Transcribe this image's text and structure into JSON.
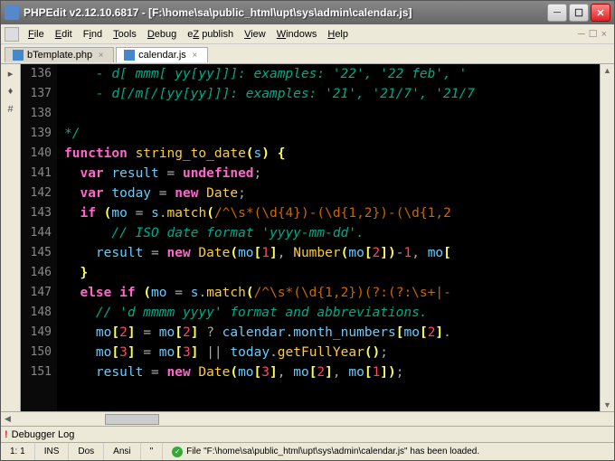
{
  "title": "PHPEdit v2.12.10.6817 - [F:\\home\\sa\\public_html\\upt\\sys\\admin\\calendar.js]",
  "menu": {
    "file": "File",
    "edit": "Edit",
    "find": "Find",
    "tools": "Tools",
    "debug": "Debug",
    "ez": "eZ publish",
    "view": "View",
    "windows": "Windows",
    "help": "Help"
  },
  "tabs": [
    {
      "label": "bTemplate.php",
      "active": false
    },
    {
      "label": "calendar.js",
      "active": true
    }
  ],
  "line_start": 136,
  "line_end": 151,
  "logbar": "Debugger Log",
  "status": {
    "pos": "1: 1",
    "ins": "INS",
    "eol": "Dos",
    "enc": "Ansi",
    "msg": "File \"F:\\home\\sa\\public_html\\upt\\sys\\admin\\calendar.js\" has been loaded."
  },
  "code": [
    [
      [
        "cm",
        "    - d[ mmm[ yy[yy]]]: examples: '22', '22 feb', '"
      ]
    ],
    [
      [
        "cm",
        "    - d[/m[/[yy[yy]]]: examples: '21', '21/7', '21/7"
      ]
    ],
    [],
    [
      [
        "cm",
        "*/"
      ]
    ],
    [
      [
        "kw",
        "function "
      ],
      [
        "fn",
        "string_to_date"
      ],
      [
        "pn",
        "("
      ],
      [
        "id",
        "s"
      ],
      [
        "pn",
        ") {"
      ]
    ],
    [
      [
        "op",
        "  "
      ],
      [
        "kw",
        "var "
      ],
      [
        "id",
        "result "
      ],
      [
        "op",
        "= "
      ],
      [
        "kw",
        "undefined"
      ],
      [
        "op",
        ";"
      ]
    ],
    [
      [
        "op",
        "  "
      ],
      [
        "kw",
        "var "
      ],
      [
        "id",
        "today "
      ],
      [
        "op",
        "= "
      ],
      [
        "kw",
        "new "
      ],
      [
        "fn",
        "Date"
      ],
      [
        "op",
        ";"
      ]
    ],
    [
      [
        "op",
        "  "
      ],
      [
        "kw",
        "if "
      ],
      [
        "pn",
        "("
      ],
      [
        "id",
        "mo "
      ],
      [
        "op",
        "= "
      ],
      [
        "id",
        "s"
      ],
      [
        "op",
        "."
      ],
      [
        "fn",
        "match"
      ],
      [
        "pn",
        "("
      ],
      [
        "re",
        "/^\\s*(\\d{4})-(\\d{1,2})-(\\d{1,2"
      ]
    ],
    [
      [
        "op",
        "      "
      ],
      [
        "cm",
        "// ISO date format 'yyyy-mm-dd'."
      ]
    ],
    [
      [
        "op",
        "    "
      ],
      [
        "id",
        "result "
      ],
      [
        "op",
        "= "
      ],
      [
        "kw",
        "new "
      ],
      [
        "fn",
        "Date"
      ],
      [
        "pn",
        "("
      ],
      [
        "id",
        "mo"
      ],
      [
        "pn",
        "["
      ],
      [
        "num",
        "1"
      ],
      [
        "pn",
        "]"
      ],
      [
        "op",
        ", "
      ],
      [
        "fn",
        "Number"
      ],
      [
        "pn",
        "("
      ],
      [
        "id",
        "mo"
      ],
      [
        "pn",
        "["
      ],
      [
        "num",
        "2"
      ],
      [
        "pn",
        "]"
      ],
      [
        "pn",
        ")"
      ],
      [
        "op",
        "-"
      ],
      [
        "num",
        "1"
      ],
      [
        "op",
        ", "
      ],
      [
        "id",
        "mo"
      ],
      [
        "pn",
        "["
      ]
    ],
    [
      [
        "op",
        "  "
      ],
      [
        "pn",
        "}"
      ]
    ],
    [
      [
        "op",
        "  "
      ],
      [
        "kw",
        "else if "
      ],
      [
        "pn",
        "("
      ],
      [
        "id",
        "mo "
      ],
      [
        "op",
        "= "
      ],
      [
        "id",
        "s"
      ],
      [
        "op",
        "."
      ],
      [
        "fn",
        "match"
      ],
      [
        "pn",
        "("
      ],
      [
        "re",
        "/^\\s*(\\d{1,2})(?:(?:\\s+|-"
      ]
    ],
    [
      [
        "op",
        "    "
      ],
      [
        "cm",
        "// 'd mmmm yyyy' format and abbreviations."
      ]
    ],
    [
      [
        "op",
        "    "
      ],
      [
        "id",
        "mo"
      ],
      [
        "pn",
        "["
      ],
      [
        "num",
        "2"
      ],
      [
        "pn",
        "] "
      ],
      [
        "op",
        "= "
      ],
      [
        "id",
        "mo"
      ],
      [
        "pn",
        "["
      ],
      [
        "num",
        "2"
      ],
      [
        "pn",
        "] "
      ],
      [
        "op",
        "? "
      ],
      [
        "id",
        "calendar"
      ],
      [
        "op",
        "."
      ],
      [
        "id",
        "month_numbers"
      ],
      [
        "pn",
        "["
      ],
      [
        "id",
        "mo"
      ],
      [
        "pn",
        "["
      ],
      [
        "num",
        "2"
      ],
      [
        "pn",
        "]"
      ],
      [
        "op",
        "."
      ]
    ],
    [
      [
        "op",
        "    "
      ],
      [
        "id",
        "mo"
      ],
      [
        "pn",
        "["
      ],
      [
        "num",
        "3"
      ],
      [
        "pn",
        "] "
      ],
      [
        "op",
        "= "
      ],
      [
        "id",
        "mo"
      ],
      [
        "pn",
        "["
      ],
      [
        "num",
        "3"
      ],
      [
        "pn",
        "] "
      ],
      [
        "op",
        "|| "
      ],
      [
        "id",
        "today"
      ],
      [
        "op",
        "."
      ],
      [
        "fn",
        "getFullYear"
      ],
      [
        "pn",
        "()"
      ],
      [
        "op",
        ";"
      ]
    ],
    [
      [
        "op",
        "    "
      ],
      [
        "id",
        "result "
      ],
      [
        "op",
        "= "
      ],
      [
        "kw",
        "new "
      ],
      [
        "fn",
        "Date"
      ],
      [
        "pn",
        "("
      ],
      [
        "id",
        "mo"
      ],
      [
        "pn",
        "["
      ],
      [
        "num",
        "3"
      ],
      [
        "pn",
        "]"
      ],
      [
        "op",
        ", "
      ],
      [
        "id",
        "mo"
      ],
      [
        "pn",
        "["
      ],
      [
        "num",
        "2"
      ],
      [
        "pn",
        "]"
      ],
      [
        "op",
        ", "
      ],
      [
        "id",
        "mo"
      ],
      [
        "pn",
        "["
      ],
      [
        "num",
        "1"
      ],
      [
        "pn",
        "])"
      ],
      [
        "op",
        ";"
      ]
    ]
  ]
}
